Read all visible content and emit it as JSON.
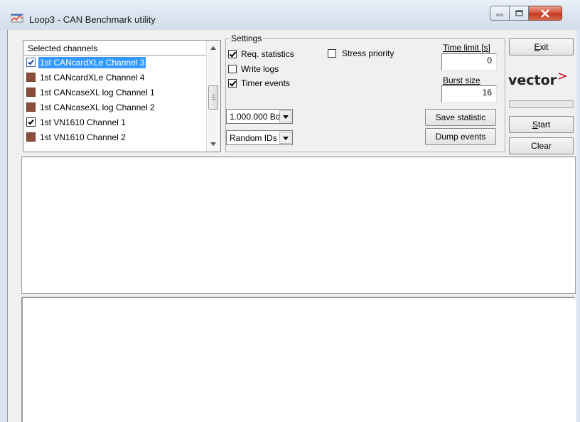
{
  "window": {
    "title": "Loop3 - CAN Benchmark utility"
  },
  "channels": {
    "header": "Selected channels",
    "items": [
      {
        "label": "1st CANcardXLe Channel 3",
        "checked": true,
        "selected": true
      },
      {
        "label": "1st CANcardXLe Channel 4",
        "checked": false,
        "selected": false
      },
      {
        "label": "1st CANcaseXL log Channel 1",
        "checked": false,
        "selected": false
      },
      {
        "label": "1st CANcaseXL log Channel 2",
        "checked": false,
        "selected": false
      },
      {
        "label": "1st VN1610 Channel 1",
        "checked": true,
        "selected": false
      },
      {
        "label": "1st VN1610 Channel 2",
        "checked": false,
        "selected": false
      }
    ]
  },
  "settings": {
    "legend": "Settings",
    "req_statistics": "Req. statistics",
    "write_logs": "Write logs",
    "timer_events": "Timer events",
    "stress_priority": "Stress priority",
    "baudrate": "1.000.000 Bd",
    "id_mode": "Random IDs",
    "time_limit_label": "Time limit [s]",
    "time_limit_value": "0",
    "burst_size_label": "Burst size",
    "burst_size_value": "16",
    "save_statistic": "Save statistic",
    "dump_events": "Dump events"
  },
  "actions": {
    "exit_rest": "xit",
    "exit_key": "E",
    "start_key": "S",
    "start_rest": "tart",
    "clear": "Clear"
  },
  "logo": "vector",
  "colors": {
    "selection": "#3399ff",
    "logo_red": "#c8102e"
  }
}
